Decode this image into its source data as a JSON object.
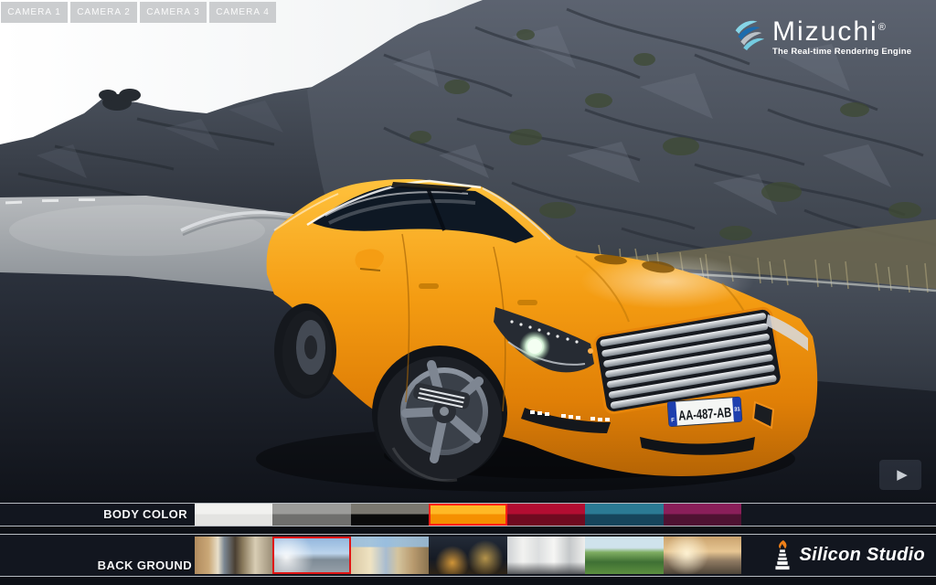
{
  "header": {
    "camera_tabs": [
      {
        "label": "CAMERA 1"
      },
      {
        "label": "CAMERA 2"
      },
      {
        "label": "CAMERA 3"
      },
      {
        "label": "CAMERA 4"
      }
    ]
  },
  "branding": {
    "logo_text": "Mizuchi",
    "registered_mark": "®",
    "tagline": "The Real-time Rendering Engine",
    "logo_wave_colors": [
      "#86d5e7",
      "#1b6cae",
      "#bac1c7",
      "#74cbe0"
    ],
    "footer_logo_text": "Silicon Studio",
    "footer_flame_color": "#f08018"
  },
  "viewport": {
    "license_plate": {
      "left_band": "F",
      "number": "AA-487-AB",
      "right_band": "31"
    },
    "car_body_color": "#f49c12"
  },
  "player": {
    "play_icon": "▶"
  },
  "body_color": {
    "label": "BODY COLOR",
    "selected_index": 3,
    "selection_border_color": "#ff2015",
    "swatches": [
      {
        "name": "white",
        "top": "#f1f1ef",
        "bottom": "#e3e3e1"
      },
      {
        "name": "silver-gray",
        "top": "#9c9c9a",
        "bottom": "#6f6f6d"
      },
      {
        "name": "black-olive",
        "top": "#7b7870",
        "bottom": "#0b0b0b"
      },
      {
        "name": "orange",
        "top": "#ffb825",
        "bottom": "#f58f00"
      },
      {
        "name": "crimson",
        "top": "#b30d32",
        "bottom": "#700a20"
      },
      {
        "name": "teal",
        "top": "#2b7a94",
        "bottom": "#16455c"
      },
      {
        "name": "plum",
        "top": "#8a1f5a",
        "bottom": "#4f1232"
      }
    ]
  },
  "background_select": {
    "label": "BACK GROUND",
    "selected_index": 1,
    "selection_border_color": "#e01515",
    "thumbnails": [
      {
        "name": "city-street-day",
        "bg": "linear-gradient(90deg,#b08a5e 0,#caa877 18%,#e8dfca 30%,#7c8894 38%,#4a3f33 52%,#8a7a5c 62%,#d8cdb4 78%,#9c8f78 100%)"
      },
      {
        "name": "mountain-road",
        "bg": "radial-gradient(circle at 18% 55%, rgba(255,255,255,.9), rgba(255,255,255,0) 40%), linear-gradient(180deg,#8fb4dc 0,#bcd4ec 45%,#7e8b96 62%,#98a2ab 100%)"
      },
      {
        "name": "city-plaza",
        "bg": "linear-gradient(180deg, rgba(150,190,225,.85) 0 28%, rgba(0,0,0,0) 28%), linear-gradient(90deg,#d9c8a4 0,#efe3c2 25%,#a8bcd0 45%,#d4c49e 60%,#b89a6e 80%,#8a7350 100%)"
      },
      {
        "name": "night-city",
        "bg": "radial-gradient(circle at 30% 70%, rgba(240,170,60,.85), rgba(0,0,0,0) 28%), radial-gradient(circle at 72% 58%, rgba(250,200,90,.7), rgba(0,0,0,0) 30%), linear-gradient(180deg,#232b38 0,#151a24 60%,#2e2417 100%)"
      },
      {
        "name": "bright-interior",
        "bg": "linear-gradient(180deg, rgba(0,0,0,0) 68%, rgba(60,62,66,.85) 100%), linear-gradient(90deg,#cfd2d4 0,#f2f2f0 20%,#dcdedf 40%,#f6f6f4 60%,#c5c8ca 80%,#eeeeec 100%)"
      },
      {
        "name": "green-park",
        "bg": "linear-gradient(180deg,#cfe3ec 0 30%,#7fae62 42%,#3f7034 68%,#5c8f3f 100%)"
      },
      {
        "name": "sunset-pier",
        "bg": "radial-gradient(circle at 30% 45%, rgba(255,244,214,.95), rgba(0,0,0,0) 38%), linear-gradient(180deg,#caa36e 0,#e7c693 40%,#8f7a62 65%,#4e4438 100%)"
      }
    ]
  }
}
